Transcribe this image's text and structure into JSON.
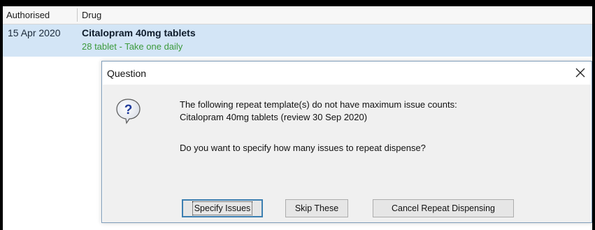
{
  "list": {
    "columns": {
      "authorised": "Authorised",
      "drug": "Drug"
    },
    "rows": [
      {
        "date": "15 Apr 2020",
        "drug": "Citalopram 40mg tablets",
        "detail": "28 tablet - Take one daily"
      }
    ]
  },
  "dialog": {
    "title": "Question",
    "icon": "question-icon",
    "message_line1": "The following repeat template(s) do not have maximum issue counts:",
    "message_line2": "Citalopram 40mg tablets (review 30 Sep 2020)",
    "message_line3": "Do you want to specify how many issues to repeat dispense?",
    "buttons": {
      "specify": "Specify Issues",
      "skip": "Skip These",
      "cancel": "Cancel Repeat Dispensing"
    }
  },
  "colors": {
    "selected_row": "#d3e5f6",
    "detail_text": "#3c9a3c",
    "dialog_body": "#f0f0f0",
    "default_button_border": "#3c7fb1"
  }
}
